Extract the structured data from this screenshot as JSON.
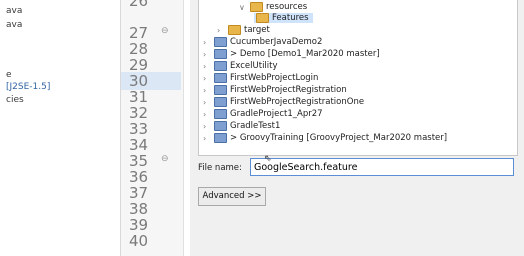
{
  "left_pane": {
    "items": [
      "ava",
      "ava",
      "e",
      "[J2SE-1.5]",
      "cies"
    ]
  },
  "editor": {
    "line_numbers": [
      "26",
      "27",
      "28",
      "29",
      "30",
      "31",
      "32",
      "33",
      "34",
      "35",
      "36",
      "37",
      "38",
      "39",
      "40"
    ]
  },
  "dialog": {
    "tree": [
      "resources",
      "Features",
      "target",
      "CucumberJavaDemo2",
      "> Demo [Demo1_Mar2020 master]",
      "ExcelUtility",
      "FirstWebProjectLogin",
      "FirstWebProjectRegistration",
      "FirstWebProjectRegistrationOne",
      "GradleProject1_Apr27",
      "GradleTest1",
      "> GroovyTraining [GroovyProject_Mar2020 master]"
    ],
    "file_name_label": "File name:",
    "file_name_value": "GoogleSearch.feature",
    "advanced_label": "Advanced >>"
  }
}
